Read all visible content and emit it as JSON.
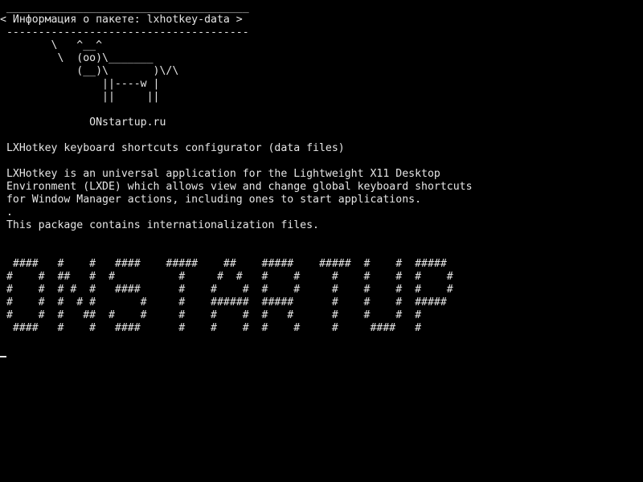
{
  "terminal": {
    "cow": {
      "border_top": " ______________________________________",
      "bubble": "< Информация о пакете: lxhotkey-data >",
      "border_bottom": " --------------------------------------",
      "art": [
        "        \\   ^__^",
        "         \\  (oo)\\_______",
        "            (__)\\       )\\/\\",
        "                ||----w |",
        "                ||     ||"
      ],
      "site": "              ONstartup.ru"
    },
    "summary": " LXHotkey keyboard shortcuts configurator (data files)",
    "description": [
      " LXHotkey is an universal application for the Lightweight X11 Desktop",
      " Environment (LXDE) which allows view and change global keyboard shortcuts",
      " for Window Manager actions, including ones to start applications.",
      " .",
      " This package contains internationalization files."
    ],
    "banner": [
      "  ####   #    #   ####    #####    ##    #####    #####  #    #  #####",
      " #    #  ##   #  #          #     #  #   #    #     #    #    #  #    #",
      " #    #  # #  #   ####      #    #    #  #    #     #    #    #  #    #",
      " #    #  #  # #       #     #    ######  #####      #    #    #  #####",
      " #    #  #   ##  #    #     #    #    #  #   #      #    #    #  #",
      "  ####   #    #   ####      #    #    #  #    #     #     ####   #"
    ]
  }
}
